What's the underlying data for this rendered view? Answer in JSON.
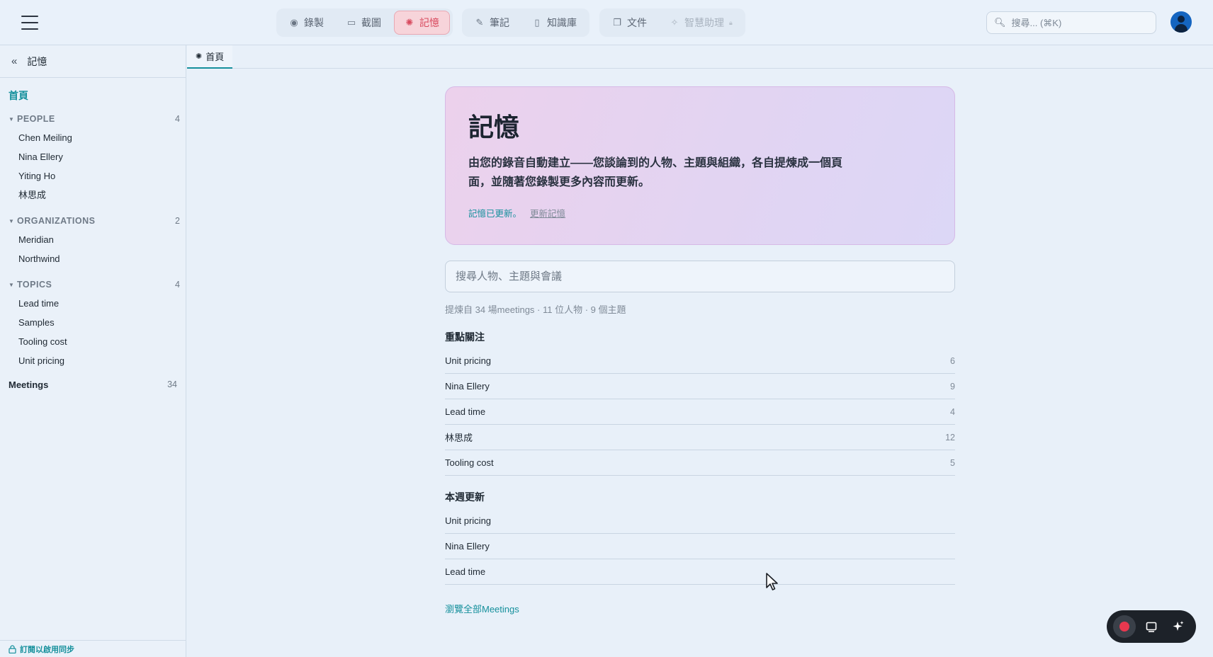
{
  "header": {
    "nav_groups": [
      [
        {
          "label": "錄製",
          "icon": "record-icon",
          "glyph": "◉",
          "state": "normal"
        },
        {
          "label": "截圖",
          "icon": "screenshot-icon",
          "glyph": "▭",
          "state": "normal"
        },
        {
          "label": "記憶",
          "icon": "memory-icon",
          "glyph": "✺",
          "state": "active"
        }
      ],
      [
        {
          "label": "筆記",
          "icon": "notes-icon",
          "glyph": "✎",
          "state": "normal"
        },
        {
          "label": "知識庫",
          "icon": "book-icon",
          "glyph": "▯",
          "state": "normal"
        }
      ],
      [
        {
          "label": "文件",
          "icon": "documents-icon",
          "glyph": "❐",
          "state": "normal"
        },
        {
          "label": "智慧助理",
          "icon": "assistant-icon",
          "glyph": "✧",
          "state": "disabled"
        }
      ]
    ],
    "search_placeholder": "搜尋... (⌘K)"
  },
  "sidebar": {
    "title": "記憶",
    "home": "首頁",
    "sections": [
      {
        "name": "PEOPLE",
        "count": "4",
        "items": [
          "Chen Meiling",
          "Nina Ellery",
          "Yiting Ho",
          "林思成"
        ]
      },
      {
        "name": "ORGANIZATIONS",
        "count": "2",
        "items": [
          "Meridian",
          "Northwind"
        ]
      },
      {
        "name": "TOPICS",
        "count": "4",
        "items": [
          "Lead time",
          "Samples",
          "Tooling cost",
          "Unit pricing"
        ]
      }
    ],
    "meetings": {
      "label": "Meetings",
      "count": "34"
    },
    "footer": "訂閱以啟用同步"
  },
  "tabs": [
    {
      "label": "首頁"
    }
  ],
  "hero": {
    "title": "記憶",
    "description": "由您的錄音自動建立——您談論到的人物、主題與組織，各自提煉成一個頁面，並隨著您錄製更多內容而更新。",
    "status": "記憶已更新。",
    "refresh": "更新記憶"
  },
  "main": {
    "search_placeholder": "搜尋人物、主題與會議",
    "stats": "提煉自 34 場meetings · 11 位人物 · 9 個主題",
    "focus_title": "重點關注",
    "focus_items": [
      {
        "label": "Unit pricing",
        "count": "6"
      },
      {
        "label": "Nina Ellery",
        "count": "9"
      },
      {
        "label": "Lead time",
        "count": "4"
      },
      {
        "label": "林思成",
        "count": "12"
      },
      {
        "label": "Tooling cost",
        "count": "5"
      }
    ],
    "weekly_title": "本週更新",
    "weekly_items": [
      {
        "label": "Unit pricing"
      },
      {
        "label": "Nina Ellery"
      },
      {
        "label": "Lead time"
      }
    ],
    "browse_all": "瀏覽全部Meetings"
  },
  "colors": {
    "accent": "#15909c",
    "active_nav": "#d84a5e",
    "record": "#e8384f"
  }
}
